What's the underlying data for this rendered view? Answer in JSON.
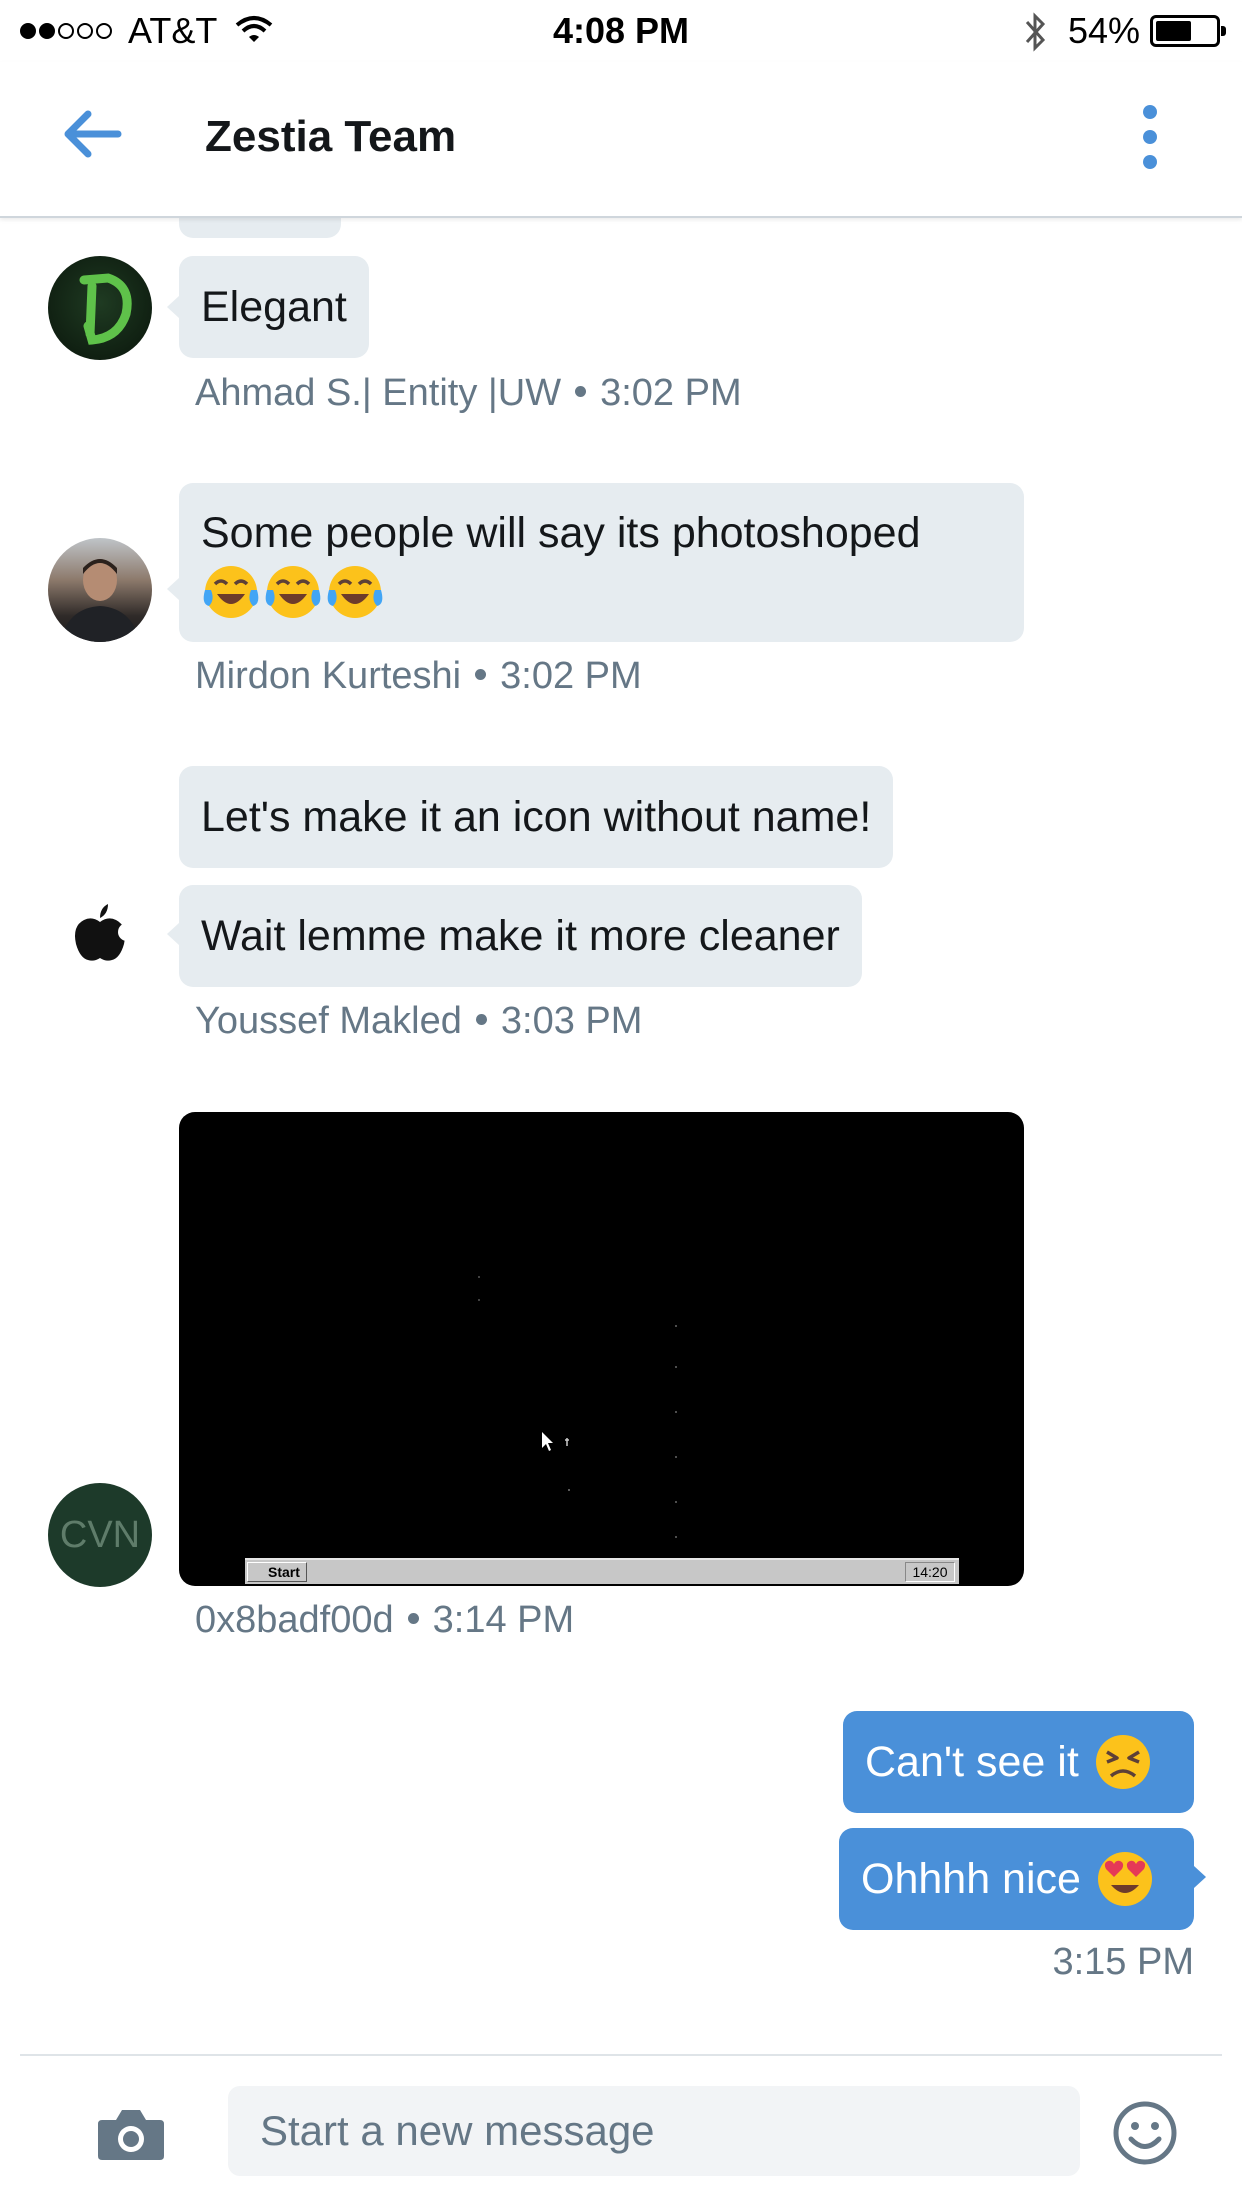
{
  "status_bar": {
    "carrier": "AT&T",
    "time": "4:08 PM",
    "battery_percent_label": "54%",
    "battery_level": 0.54,
    "signal_bars_filled": 2,
    "signal_bars_total": 5
  },
  "header": {
    "title": "Zestia Team"
  },
  "messages": [
    {
      "group": "ahmad",
      "bubbles": [
        "Elegant"
      ],
      "meta": {
        "sender": "Ahmad S.| Entity |UW",
        "time": "3:02 PM"
      }
    },
    {
      "group": "mirdon",
      "bubbles": [
        "Some people will say its photoshoped"
      ],
      "meta": {
        "sender": "Mirdon Kurteshi",
        "time": "3:02 PM"
      }
    },
    {
      "group": "youssef",
      "bubbles": [
        "Let's make it an icon without name!",
        "Wait lemme make it more cleaner"
      ],
      "meta": {
        "sender": "Youssef Makled",
        "time": "3:03 PM"
      }
    },
    {
      "group": "cvn",
      "attachment": {
        "type": "image",
        "taskbar_start": "Start",
        "taskbar_clock": "14:20"
      },
      "avatar_label": "CVN",
      "meta": {
        "sender": "0x8badf00d",
        "time": "3:14 PM"
      }
    },
    {
      "group": "me",
      "bubbles": [
        "Can't see it",
        "Ohhhh nice"
      ],
      "meta": {
        "time": "3:15 PM"
      }
    }
  ],
  "composer": {
    "placeholder": "Start a new message"
  },
  "colors": {
    "accent": "#4a90d9",
    "incoming_bubble": "#e6ecf0",
    "meta_text": "#657786"
  },
  "icons": {
    "back": "arrow-left-icon",
    "more": "vertical-dots-icon",
    "camera": "camera-icon",
    "emoji": "smiley-icon"
  }
}
